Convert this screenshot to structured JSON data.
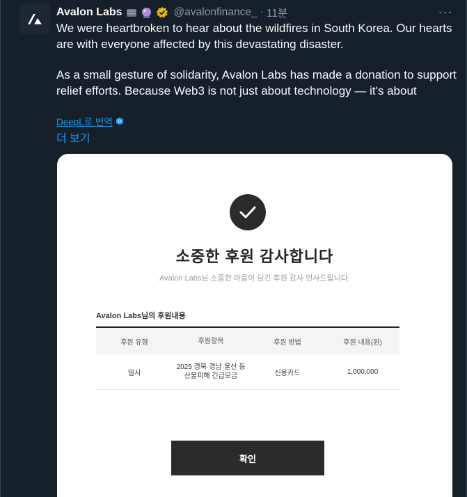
{
  "tweet": {
    "author_name": "Avalon Labs",
    "handle": "@avalonfinance_",
    "separator": "·",
    "time": "11분",
    "more_label": "···",
    "paragraph_1": "We were heartbroken to hear about the wildfires in South Korea. Our hearts are with everyone affected by this devastating disaster.",
    "paragraph_2": "As a small gesture of solidarity, Avalon Labs has made a donation to support relief efforts. Because Web3 is not just about technology — it's about",
    "translate_label": "DeepL로 번역",
    "show_more_label": "더 보기"
  },
  "receipt": {
    "title": "소중한 후원 감사합니다",
    "subtitle": "Avalon Labs님 소중한 마음이 담긴 후원 감사 인사드립니다.",
    "section_label": "Avalon Labs님의 후원내용",
    "columns": [
      "후원 유형",
      "후원항목",
      "후원 방법",
      "후원 내용(원)"
    ],
    "row": {
      "type": "일시",
      "item_line1": "2025 경북·경남·울산 등",
      "item_line2": "산불피해 긴급모금",
      "method": "신용카드",
      "amount": "1,000,000"
    },
    "confirm_label": "확인"
  },
  "colors": {
    "background": "#15202b",
    "accent": "#1d9bf0",
    "verified": "#e2b719"
  }
}
